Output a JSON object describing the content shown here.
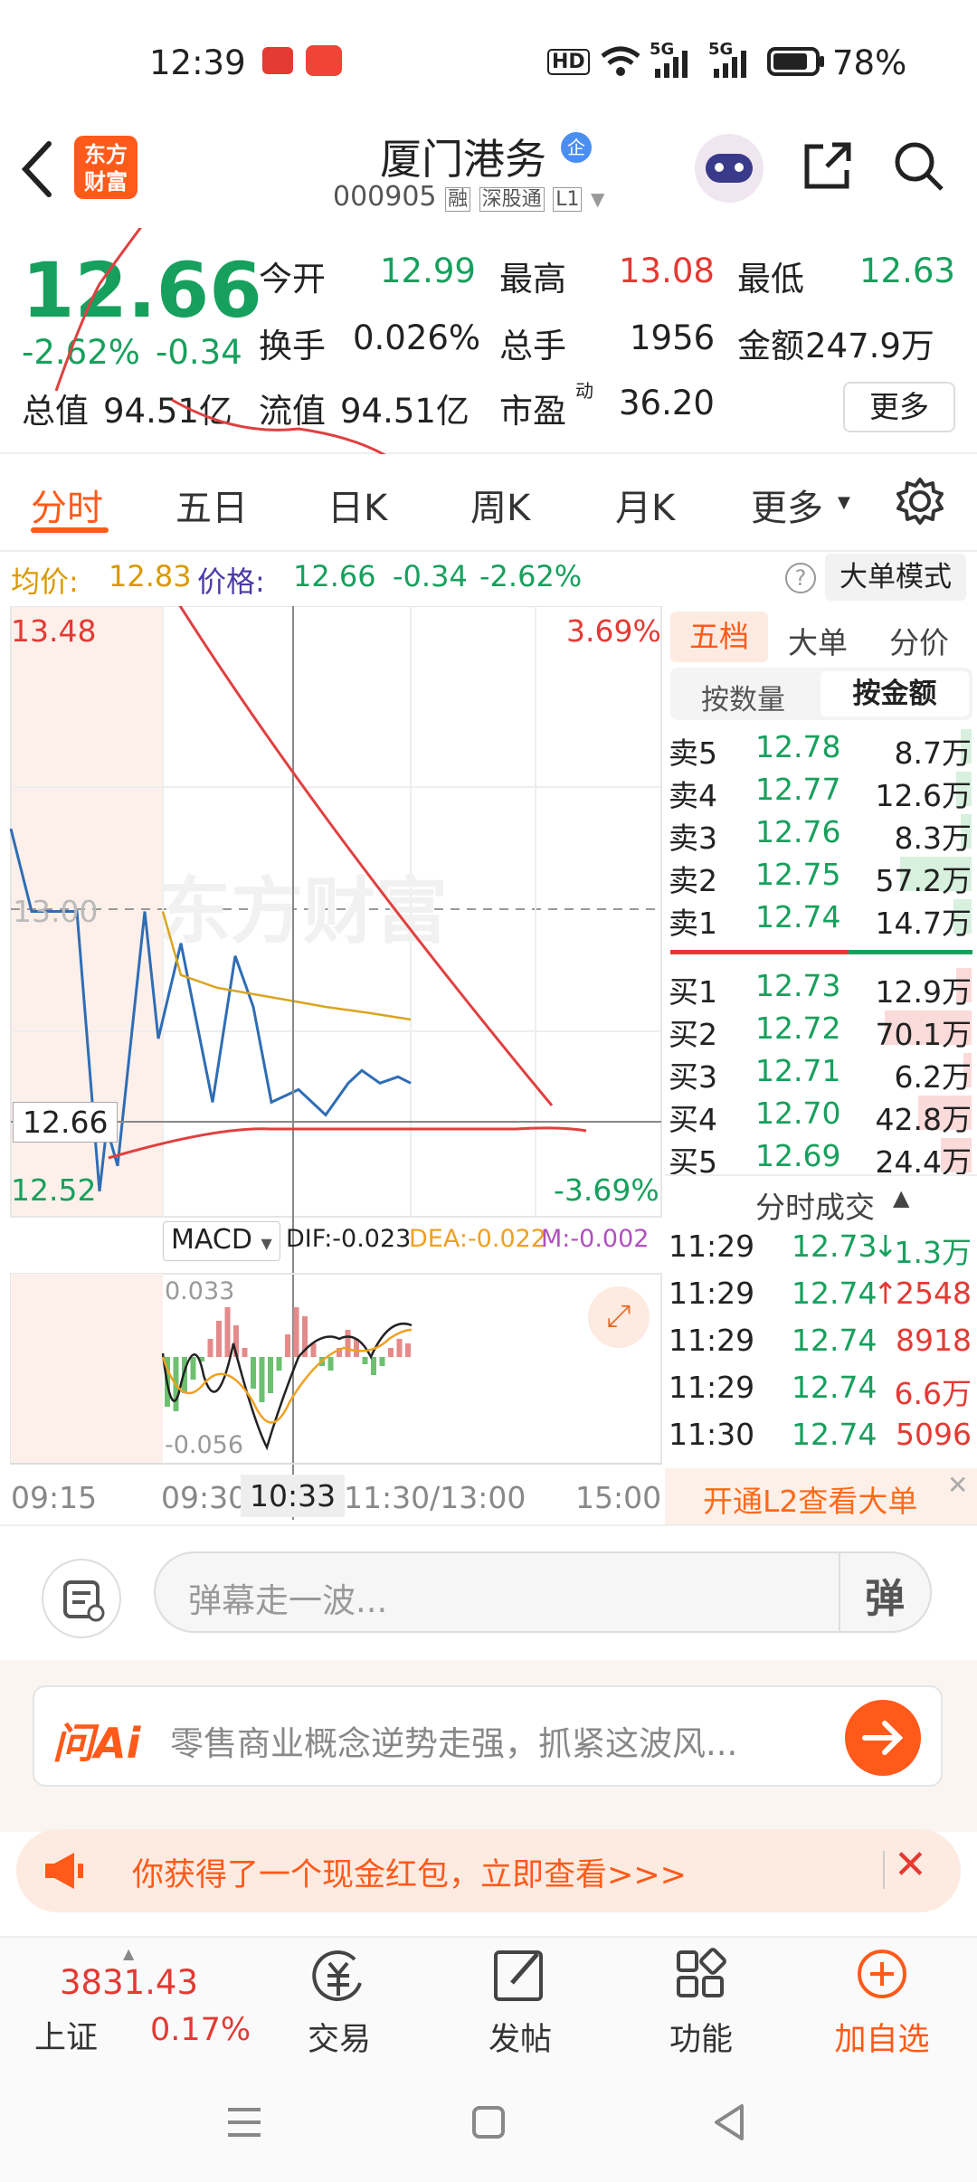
{
  "status_bar": {
    "time": "12:39",
    "battery": "78%",
    "net1": "5G",
    "net2": "5G",
    "hd": "HD"
  },
  "header": {
    "logo_line1": "东方",
    "logo_line2": "财富",
    "stock_name": "厦门港务",
    "badge": "企",
    "stock_code": "000905",
    "tag_margin": "融",
    "tag_connect": "深股通",
    "tag_level": "L1"
  },
  "quote": {
    "price": "12.66",
    "change_pct": "-2.62%",
    "change": "-0.34",
    "open_label": "今开",
    "open": "12.99",
    "high_label": "最高",
    "high": "13.08",
    "low_label": "最低",
    "low": "12.63",
    "turnover_label": "换手",
    "turnover": "0.026%",
    "volume_label": "总手",
    "volume": "1956",
    "amount_label": "金额",
    "amount": "247.9万",
    "mcap_label": "总值",
    "mcap": "94.51亿",
    "float_label": "流值",
    "float": "94.51亿",
    "pe_label": "市盈",
    "pe_sup": "动",
    "pe": "36.20",
    "more": "更多"
  },
  "tabs": [
    "分时",
    "五日",
    "日K",
    "周K",
    "月K",
    "更多"
  ],
  "active_tab": 0,
  "info": {
    "avg_label": "均价:",
    "avg": "12.83",
    "price_label": "价格:",
    "price": "12.66",
    "change": "-0.34",
    "pct": "-2.62%",
    "help": "?",
    "mode_btn": "大单模式"
  },
  "chart_labels": {
    "top_price": "13.48",
    "top_pct": "3.69%",
    "mid_price": "13.00",
    "cross_price": "12.66",
    "bottom_price": "12.52",
    "bottom_pct": "-3.69%",
    "watermark": "东方财富"
  },
  "macd": {
    "name": "MACD",
    "dif": "DIF:-0.023",
    "dea": "DEA:-0.022",
    "m": "M:-0.002",
    "top": "0.033",
    "bottom": "-0.056"
  },
  "time_axis": {
    "t1": "09:15",
    "t2": "09:30",
    "cross_time": "10:33",
    "t3": "11:30/13:00",
    "t4": "15:00"
  },
  "side_tabs": [
    "五档",
    "大单",
    "分价"
  ],
  "sub_tabs": [
    "按数量",
    "按金额"
  ],
  "asks": [
    {
      "label": "卖5",
      "price": "12.78",
      "amount": "8.7万",
      "bar": 0.12
    },
    {
      "label": "卖4",
      "price": "12.77",
      "amount": "12.6万",
      "bar": 0.18
    },
    {
      "label": "卖3",
      "price": "12.76",
      "amount": "8.3万",
      "bar": 0.12
    },
    {
      "label": "卖2",
      "price": "12.75",
      "amount": "57.2万",
      "bar": 0.82
    },
    {
      "label": "卖1",
      "price": "12.74",
      "amount": "14.7万",
      "bar": 0.21
    }
  ],
  "bids": [
    {
      "label": "买1",
      "price": "12.73",
      "amount": "12.9万",
      "bar": 0.18
    },
    {
      "label": "买2",
      "price": "12.72",
      "amount": "70.1万",
      "bar": 1.0
    },
    {
      "label": "买3",
      "price": "12.71",
      "amount": "6.2万",
      "bar": 0.09
    },
    {
      "label": "买4",
      "price": "12.70",
      "amount": "42.8万",
      "bar": 0.61
    },
    {
      "label": "买5",
      "price": "12.69",
      "amount": "24.4万",
      "bar": 0.35
    }
  ],
  "trades_title": "分时成交",
  "trades": [
    {
      "time": "11:29",
      "price": "12.73",
      "arrow": "↓",
      "vol": "1.3万",
      "color": "#17a05d"
    },
    {
      "time": "11:29",
      "price": "12.74",
      "arrow": "↑",
      "vol": "2548",
      "color": "#e33a33"
    },
    {
      "time": "11:29",
      "price": "12.74",
      "arrow": "",
      "vol": "8918",
      "color": "#e33a33"
    },
    {
      "time": "11:29",
      "price": "12.74",
      "arrow": "",
      "vol": "6.6万",
      "color": "#e33a33"
    },
    {
      "time": "11:30",
      "price": "12.74",
      "arrow": "",
      "vol": "5096",
      "color": "#e33a33"
    }
  ],
  "l2_promo": "开通L2查看大单",
  "danmu_placeholder": "弹幕走一波...",
  "danmu_btn": "弹",
  "ai": {
    "logo": "问Ai",
    "text": "零售商业概念逆势走强，抓紧这波风..."
  },
  "redpack_text": "你获得了一个现金红包，立即查看>>>",
  "bottom": {
    "index_value": "3831.43",
    "index_name": "上证",
    "index_pct": "0.17%",
    "items": [
      "交易",
      "发帖",
      "功能",
      "加自选"
    ]
  },
  "chart_data": {
    "type": "line",
    "title": "",
    "ylim": [
      12.52,
      13.48
    ],
    "series": [
      {
        "name": "价格",
        "values": [
          13.13,
          13.0,
          13.0,
          13.0,
          12.56,
          12.66,
          12.6,
          13.0,
          12.8,
          12.95,
          12.7,
          12.93,
          12.85,
          12.7,
          12.72,
          12.68,
          12.73,
          12.75,
          12.73,
          12.74,
          12.73
        ]
      },
      {
        "name": "均价",
        "values": [
          13.0,
          12.9,
          12.88,
          12.87,
          12.86,
          12.85,
          12.84,
          12.83
        ]
      }
    ],
    "macd": {
      "range": [
        -0.056,
        0.033
      ],
      "dif": -0.023,
      "dea": -0.022,
      "m": -0.002
    }
  }
}
